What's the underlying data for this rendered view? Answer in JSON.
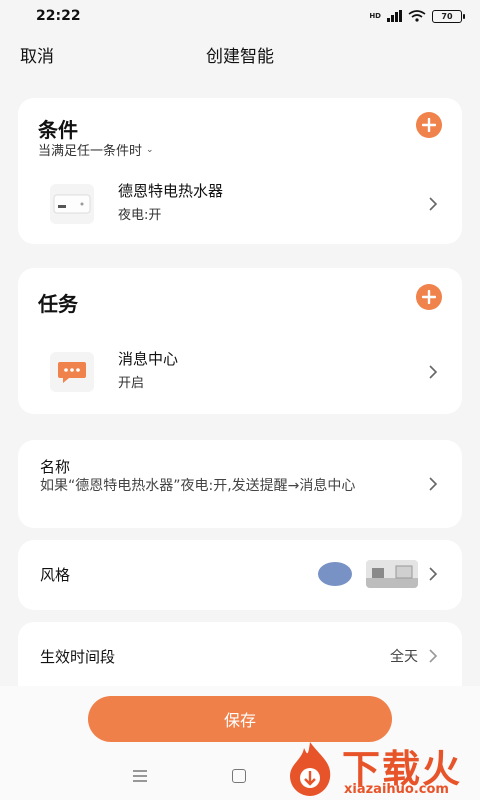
{
  "status_bar": {
    "time": "22:22",
    "network": "HD",
    "battery": "70"
  },
  "header": {
    "cancel": "取消",
    "title": "创建智能"
  },
  "conditions": {
    "title": "条件",
    "mode": "当满足任一条件时",
    "items": [
      {
        "name": "德恩特电热水器",
        "desc": "夜电:开",
        "icon": "water-heater-icon"
      }
    ]
  },
  "tasks": {
    "title": "任务",
    "items": [
      {
        "name": "消息中心",
        "desc": "开启",
        "icon": "message-icon"
      }
    ]
  },
  "name_row": {
    "label": "名称",
    "value": "如果“德恩特电热水器”夜电:开,发送提醒→消息中心"
  },
  "style_row": {
    "label": "风格",
    "swatch_color": "#7892c6"
  },
  "time_row": {
    "label": "生效时间段",
    "value": "全天"
  },
  "save": {
    "label": "保存"
  },
  "watermark": {
    "title": "下载火",
    "subtitle": "xiazaihuo.com"
  },
  "colors": {
    "accent": "#f08049",
    "background": "#f5f5f5"
  }
}
